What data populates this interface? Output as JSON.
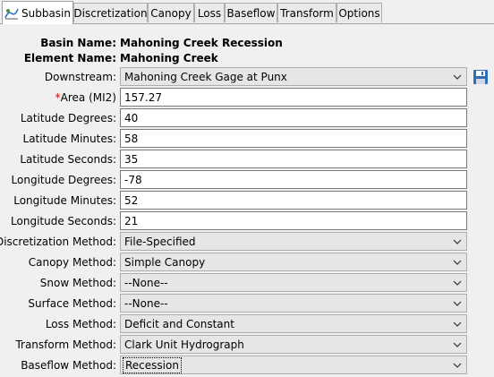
{
  "tabs": [
    {
      "label": "Subbasin",
      "icon": "subbasin-icon"
    },
    {
      "label": "Discretization"
    },
    {
      "label": "Canopy"
    },
    {
      "label": "Loss"
    },
    {
      "label": "Baseflow"
    },
    {
      "label": "Transform"
    },
    {
      "label": "Options"
    }
  ],
  "basin": {
    "label": "Basin Name:",
    "value": "Mahoning Creek Recession"
  },
  "element": {
    "label": "Element Name:",
    "value": "Mahoning Creek"
  },
  "downstream": {
    "label": "Downstream:",
    "value": "Mahoning Creek Gage at Punx",
    "button_icon": "save-disk-icon"
  },
  "area": {
    "required_marker": "*",
    "label": "Area (MI2)",
    "value": "157.27"
  },
  "lat_deg": {
    "label": "Latitude Degrees:",
    "value": "40"
  },
  "lat_min": {
    "label": "Latitude Minutes:",
    "value": "58"
  },
  "lat_sec": {
    "label": "Latitude Seconds:",
    "value": "35"
  },
  "lon_deg": {
    "label": "Longitude Degrees:",
    "value": "-78"
  },
  "lon_min": {
    "label": "Longitude Minutes:",
    "value": "52"
  },
  "lon_sec": {
    "label": "Longitude Seconds:",
    "value": "21"
  },
  "discretization": {
    "label": "Discretization Method:",
    "value": "File-Specified"
  },
  "canopy": {
    "label": "Canopy Method:",
    "value": "Simple Canopy"
  },
  "snow": {
    "label": "Snow Method:",
    "value": "--None--"
  },
  "surface": {
    "label": "Surface Method:",
    "value": "--None--"
  },
  "loss": {
    "label": "Loss Method:",
    "value": "Deficit and Constant"
  },
  "transform": {
    "label": "Transform Method:",
    "value": "Clark Unit Hydrograph"
  },
  "baseflow": {
    "label": "Baseflow Method:",
    "value": "Recession"
  },
  "colors": {
    "required": "#d00000",
    "combo_bg": "#e6e6e6",
    "panel_bg": "#f0f0f0"
  }
}
